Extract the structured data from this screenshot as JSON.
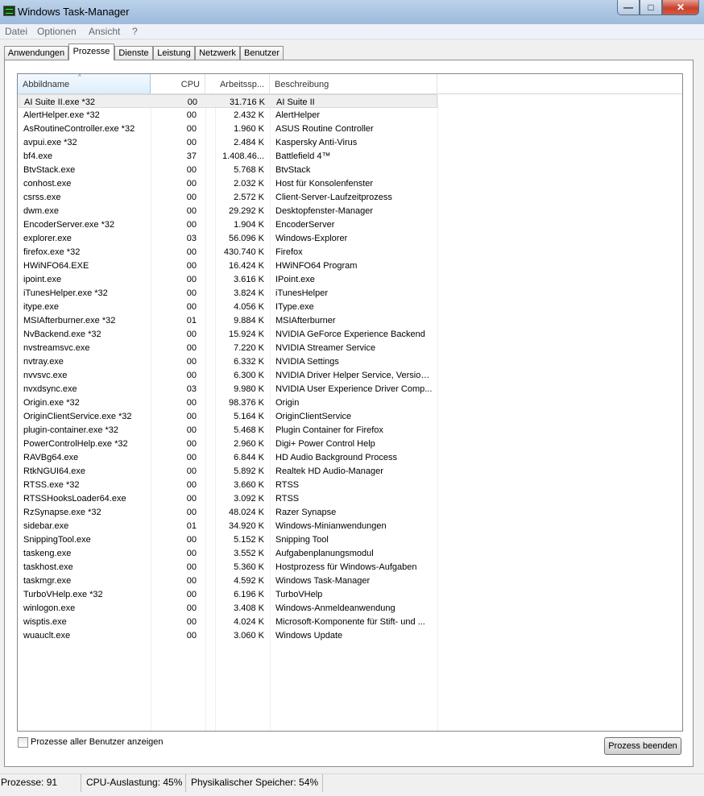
{
  "window": {
    "title": "Windows Task-Manager",
    "min_label": "—",
    "max_label": "□",
    "close_label": "✕"
  },
  "menu": [
    "Datei",
    "Optionen",
    "Ansicht",
    "?"
  ],
  "tabs": [
    "Anwendungen",
    "Prozesse",
    "Dienste",
    "Leistung",
    "Netzwerk",
    "Benutzer"
  ],
  "active_tab": "Prozesse",
  "columns": {
    "name": "Abbildname",
    "cpu": "CPU",
    "mem": "Arbeitssp...",
    "desc": "Beschreibung",
    "sort_arrow": "^"
  },
  "processes": [
    {
      "name": "AI Suite II.exe *32",
      "cpu": "00",
      "mem": "31.716 K",
      "desc": "AI Suite II"
    },
    {
      "name": "AlertHelper.exe *32",
      "cpu": "00",
      "mem": "2.432 K",
      "desc": "AlertHelper"
    },
    {
      "name": "AsRoutineController.exe *32",
      "cpu": "00",
      "mem": "1.960 K",
      "desc": "ASUS Routine Controller"
    },
    {
      "name": "avpui.exe *32",
      "cpu": "00",
      "mem": "2.484 K",
      "desc": "Kaspersky Anti-Virus"
    },
    {
      "name": "bf4.exe",
      "cpu": "37",
      "mem": "1.408.46...",
      "desc": "Battlefield 4™"
    },
    {
      "name": "BtvStack.exe",
      "cpu": "00",
      "mem": "5.768 K",
      "desc": "BtvStack"
    },
    {
      "name": "conhost.exe",
      "cpu": "00",
      "mem": "2.032 K",
      "desc": "Host für Konsolenfenster"
    },
    {
      "name": "csrss.exe",
      "cpu": "00",
      "mem": "2.572 K",
      "desc": "Client-Server-Laufzeitprozess"
    },
    {
      "name": "dwm.exe",
      "cpu": "00",
      "mem": "29.292 K",
      "desc": "Desktopfenster-Manager"
    },
    {
      "name": "EncoderServer.exe *32",
      "cpu": "00",
      "mem": "1.904 K",
      "desc": "EncoderServer"
    },
    {
      "name": "explorer.exe",
      "cpu": "03",
      "mem": "56.096 K",
      "desc": "Windows-Explorer"
    },
    {
      "name": "firefox.exe *32",
      "cpu": "00",
      "mem": "430.740 K",
      "desc": "Firefox"
    },
    {
      "name": "HWiNFO64.EXE",
      "cpu": "00",
      "mem": "16.424 K",
      "desc": "HWiNFO64 Program"
    },
    {
      "name": "ipoint.exe",
      "cpu": "00",
      "mem": "3.616 K",
      "desc": "IPoint.exe"
    },
    {
      "name": "iTunesHelper.exe *32",
      "cpu": "00",
      "mem": "3.824 K",
      "desc": "iTunesHelper"
    },
    {
      "name": "itype.exe",
      "cpu": "00",
      "mem": "4.056 K",
      "desc": "IType.exe"
    },
    {
      "name": "MSIAfterburner.exe *32",
      "cpu": "01",
      "mem": "9.884 K",
      "desc": "MSIAfterburner"
    },
    {
      "name": "NvBackend.exe *32",
      "cpu": "00",
      "mem": "15.924 K",
      "desc": "NVIDIA GeForce Experience Backend"
    },
    {
      "name": "nvstreamsvc.exe",
      "cpu": "00",
      "mem": "7.220 K",
      "desc": "NVIDIA Streamer Service"
    },
    {
      "name": "nvtray.exe",
      "cpu": "00",
      "mem": "6.332 K",
      "desc": "NVIDIA Settings"
    },
    {
      "name": "nvvsvc.exe",
      "cpu": "00",
      "mem": "6.300 K",
      "desc": "NVIDIA Driver Helper Service, Version..."
    },
    {
      "name": "nvxdsync.exe",
      "cpu": "03",
      "mem": "9.980 K",
      "desc": "NVIDIA User Experience Driver Comp..."
    },
    {
      "name": "Origin.exe *32",
      "cpu": "00",
      "mem": "98.376 K",
      "desc": "Origin"
    },
    {
      "name": "OriginClientService.exe *32",
      "cpu": "00",
      "mem": "5.164 K",
      "desc": "OriginClientService"
    },
    {
      "name": "plugin-container.exe *32",
      "cpu": "00",
      "mem": "5.468 K",
      "desc": "Plugin Container for Firefox"
    },
    {
      "name": "PowerControlHelp.exe *32",
      "cpu": "00",
      "mem": "2.960 K",
      "desc": "Digi+ Power Control Help"
    },
    {
      "name": "RAVBg64.exe",
      "cpu": "00",
      "mem": "6.844 K",
      "desc": "HD Audio Background Process"
    },
    {
      "name": "RtkNGUI64.exe",
      "cpu": "00",
      "mem": "5.892 K",
      "desc": "Realtek HD Audio-Manager"
    },
    {
      "name": "RTSS.exe *32",
      "cpu": "00",
      "mem": "3.660 K",
      "desc": "RTSS"
    },
    {
      "name": "RTSSHooksLoader64.exe",
      "cpu": "00",
      "mem": "3.092 K",
      "desc": "RTSS"
    },
    {
      "name": "RzSynapse.exe *32",
      "cpu": "00",
      "mem": "48.024 K",
      "desc": "Razer Synapse"
    },
    {
      "name": "sidebar.exe",
      "cpu": "01",
      "mem": "34.920 K",
      "desc": "Windows-Minianwendungen"
    },
    {
      "name": "SnippingTool.exe",
      "cpu": "00",
      "mem": "5.152 K",
      "desc": "Snipping Tool"
    },
    {
      "name": "taskeng.exe",
      "cpu": "00",
      "mem": "3.552 K",
      "desc": "Aufgabenplanungsmodul"
    },
    {
      "name": "taskhost.exe",
      "cpu": "00",
      "mem": "5.360 K",
      "desc": "Hostprozess für Windows-Aufgaben"
    },
    {
      "name": "taskmgr.exe",
      "cpu": "00",
      "mem": "4.592 K",
      "desc": "Windows Task-Manager"
    },
    {
      "name": "TurboVHelp.exe *32",
      "cpu": "00",
      "mem": "6.196 K",
      "desc": "TurboVHelp"
    },
    {
      "name": "winlogon.exe",
      "cpu": "00",
      "mem": "3.408 K",
      "desc": "Windows-Anmeldeanwendung"
    },
    {
      "name": "wisptis.exe",
      "cpu": "00",
      "mem": "4.024 K",
      "desc": "Microsoft-Komponente für Stift- und ..."
    },
    {
      "name": "wuauclt.exe",
      "cpu": "00",
      "mem": "3.060 K",
      "desc": "Windows Update"
    }
  ],
  "show_all_users_label": "Prozesse aller Benutzer anzeigen",
  "show_all_users_checked": false,
  "end_process_label": "Prozess beenden",
  "status": {
    "processes": "Prozesse: 91",
    "cpu": "CPU-Auslastung: 45%",
    "memory": "Physikalischer Speicher: 54%"
  }
}
